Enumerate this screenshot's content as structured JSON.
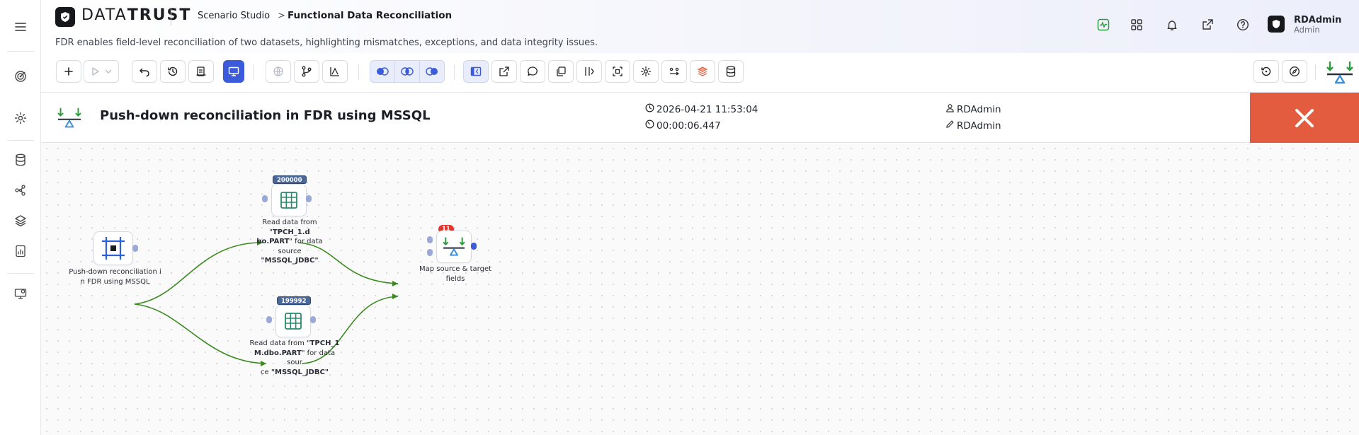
{
  "header": {
    "logo_data": "DATA",
    "logo_trust": "TRUST",
    "breadcrumb_root": "Scenario Studio",
    "breadcrumb_sep": ">",
    "breadcrumb_current": "Functional Data Reconciliation",
    "subtitle": "FDR enables field-level reconciliation of two datasets, highlighting mismatches, exceptions, and data integrity issues.",
    "icons": [
      "activity-icon",
      "grid-icon",
      "bell-icon",
      "external-link-icon",
      "help-icon"
    ]
  },
  "user": {
    "name": "RDAdmin",
    "role": "Admin"
  },
  "rail": {
    "icons": [
      "menu-icon",
      "target-icon",
      "gear-icon",
      "database-icon",
      "share-graph-icon",
      "layers-icon",
      "report-icon",
      "monitor-icon"
    ]
  },
  "reconciliation": {
    "title": "Push-down reconciliation in FDR using MSSQL",
    "timestamp": "2026-04-21 11:53:04",
    "duration": "00:00:06.447",
    "created_by": "RDAdmin",
    "edited_by": "RDAdmin"
  },
  "canvas": {
    "source_node": {
      "label_line1": "Push-down reconciliation i",
      "label_line2": "n FDR using MSSQL"
    },
    "read_node_1": {
      "count": "200000",
      "label_pre": "Read data from \"",
      "label_bold1": "TPCH_1.d",
      "label_bold2": "bo.PART",
      "label_mid": "\" for data source",
      "label_bold3": "\"MSSQL_JDBC\""
    },
    "read_node_2": {
      "count": "199992",
      "label_pre": "Read data from \"",
      "label_bold1": "TPCH_1",
      "label_bold2": "M.dbo.PART",
      "label_mid": "\" for data sour",
      "label_mid2": "ce ",
      "label_bold3": "\"MSSQL_JDBC\""
    },
    "map_node": {
      "count": "11",
      "label": "Map source & target fields"
    }
  },
  "colors": {
    "accent": "#3b5bdb",
    "close": "#e45c3f",
    "edge": "#3a8a1f",
    "badge_blue": "#4a6796",
    "badge_red": "#e5352b"
  }
}
